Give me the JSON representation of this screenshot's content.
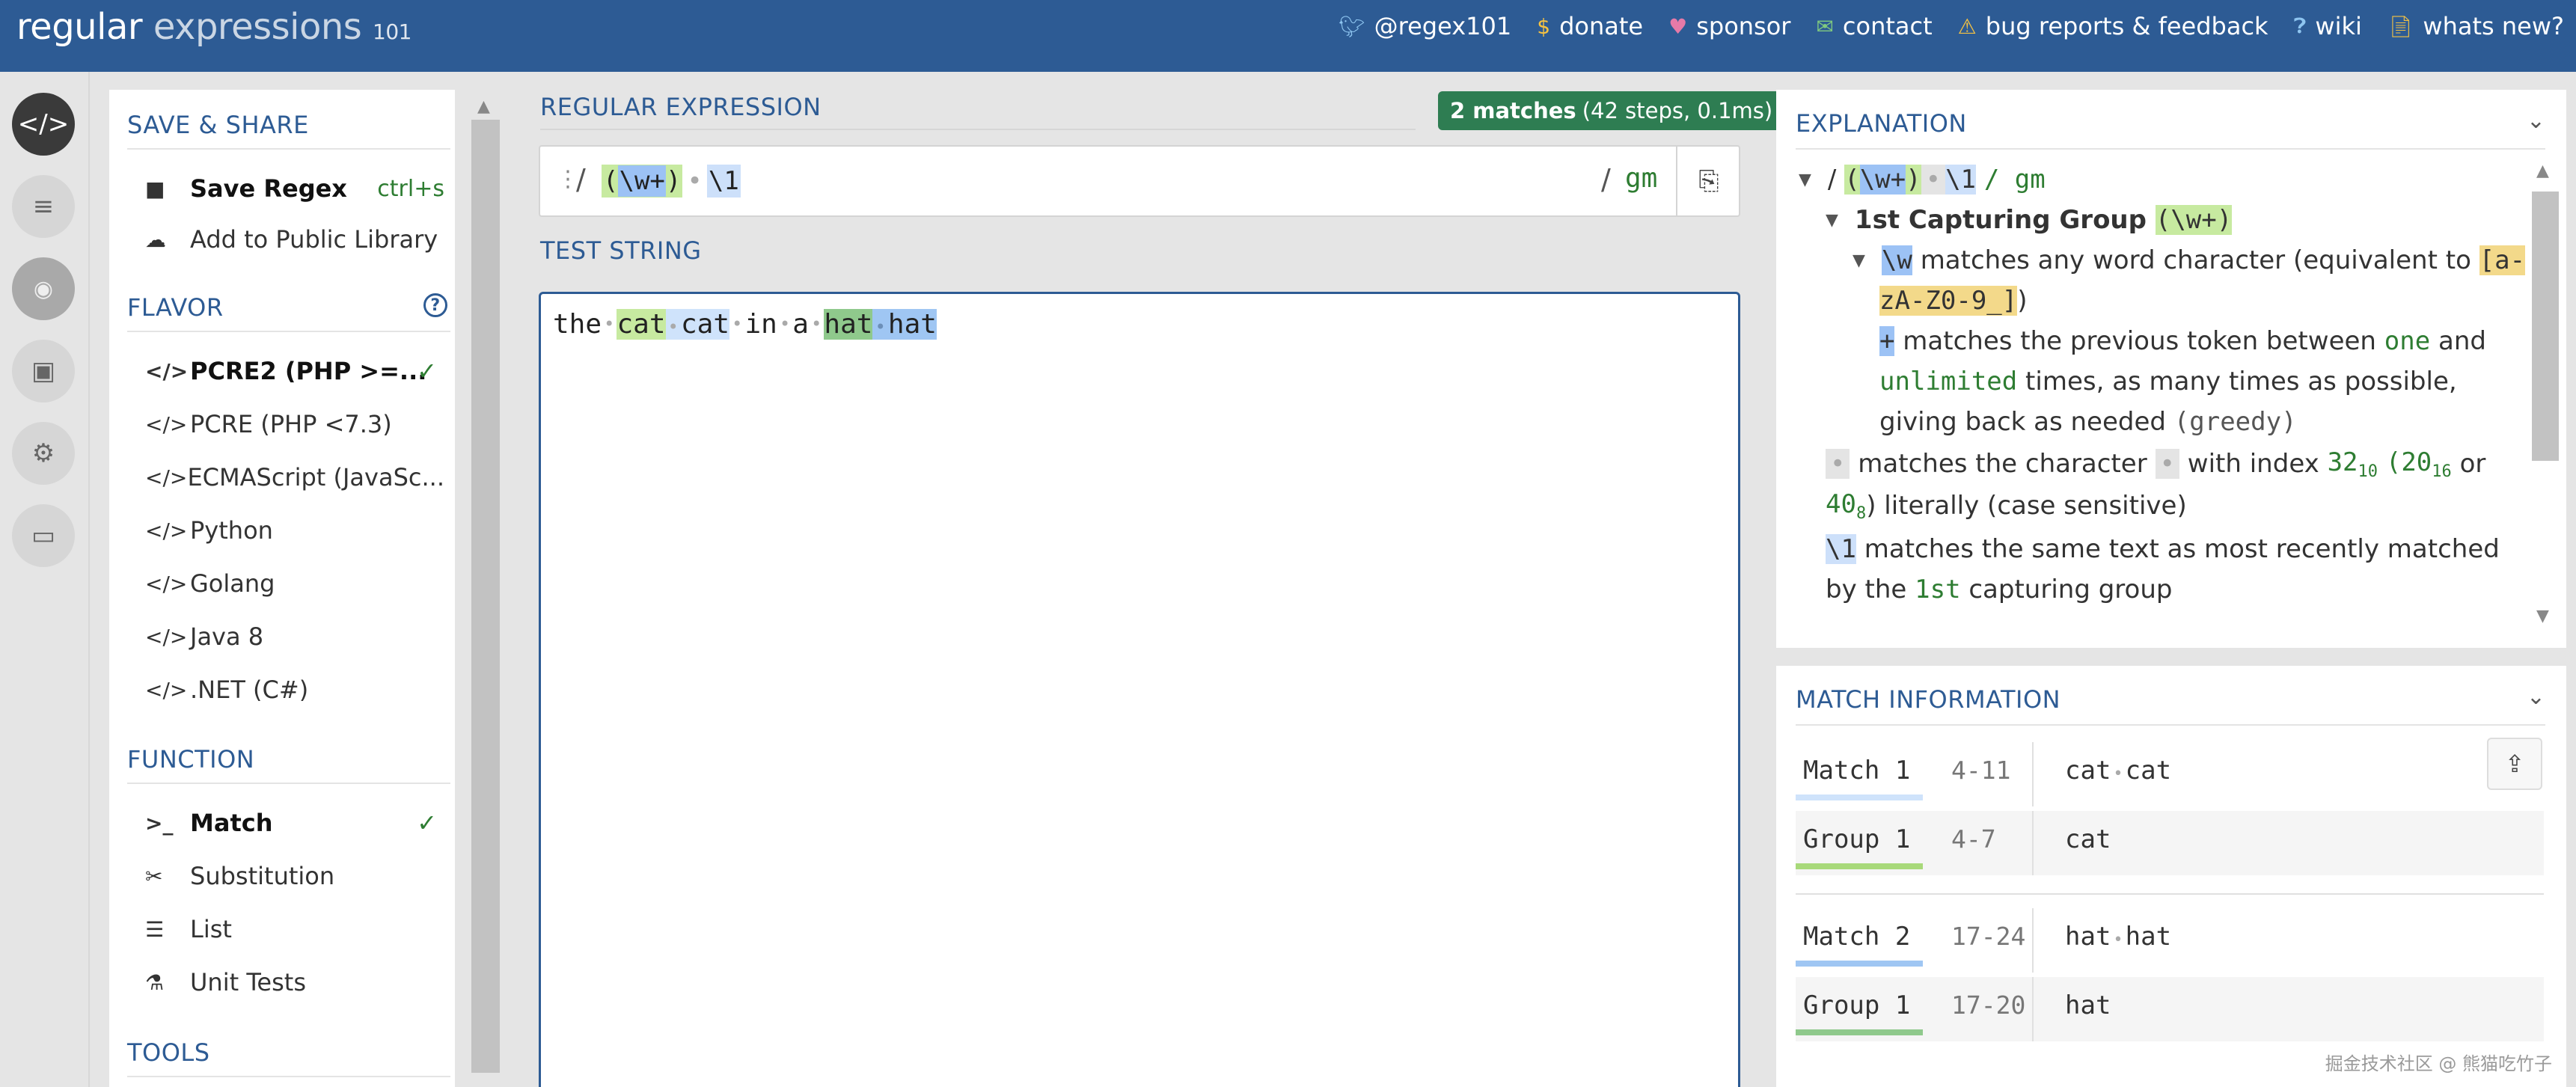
{
  "header": {
    "logo_main": "regular",
    "logo_light": "expressions",
    "logo_sup": "101",
    "nav": [
      {
        "icon": "twitter-icon",
        "label": "@regex101"
      },
      {
        "icon": "dollar-icon",
        "label": "donate"
      },
      {
        "icon": "heart-icon",
        "label": "sponsor"
      },
      {
        "icon": "mail-icon",
        "label": "contact"
      },
      {
        "icon": "warning-icon",
        "label": "bug reports & feedback"
      },
      {
        "icon": "wiki-icon",
        "label": "wiki"
      },
      {
        "icon": "news-icon",
        "label": "whats new?"
      }
    ]
  },
  "rail": [
    "code-icon",
    "library-icon",
    "avatar",
    "gamepad-icon",
    "gear-icon",
    "chat-icon"
  ],
  "sidebar": {
    "save_share": {
      "title": "SAVE & SHARE",
      "save_label": "Save Regex",
      "save_shortcut": "ctrl+s",
      "library_label": "Add to Public Library"
    },
    "flavor": {
      "title": "FLAVOR",
      "items": [
        "PCRE2 (PHP >=...",
        "PCRE (PHP <7.3)",
        "ECMAScript (JavaSc...",
        "Python",
        "Golang",
        "Java 8",
        ".NET (C#)"
      ],
      "selected": 0
    },
    "function": {
      "title": "FUNCTION",
      "items": [
        "Match",
        "Substitution",
        "List",
        "Unit Tests"
      ],
      "selected": 0
    },
    "tools": {
      "title": "TOOLS"
    }
  },
  "editor": {
    "regex_label": "REGULAR EXPRESSION",
    "match_count": "2 matches",
    "match_stats": "(42 steps, 0.1ms)",
    "delim_open": "/",
    "regex_group": "(\\w+)",
    "regex_w": "\\w+",
    "regex_back": "\\1",
    "space_mark": "•",
    "delim_close": "/",
    "flags": "gm",
    "test_label": "TEST STRING",
    "test_string": "the cat cat in a hat hat",
    "test_words": [
      "the",
      "cat",
      "cat",
      "in",
      "a",
      "hat",
      "hat"
    ]
  },
  "explanation": {
    "title": "EXPLANATION",
    "root_delim": "/",
    "root_flags": "/ gm",
    "group_title": "1st Capturing Group",
    "group_token": "(\\w+)",
    "w_token": "\\w",
    "w_text": "matches any word character (equivalent to",
    "w_class_1": "[a-",
    "w_class_2": "zA-Z0-9_]",
    "w_close": ")",
    "plus_token": "+",
    "plus_text_1": "matches the previous token between",
    "plus_one": "one",
    "plus_and": "and",
    "plus_unlimited": "unlimited",
    "plus_text_2": "times, as many times as possible,",
    "plus_text_3": "giving back as needed",
    "plus_greedy": "(greedy)",
    "space_text_1": "matches the character",
    "space_text_2": "with index",
    "idx_dec": "32",
    "idx_dec_base": "10",
    "idx_hex": "(20",
    "idx_hex_base": "16",
    "idx_or": "or",
    "idx_oct": "40",
    "idx_oct_base": "8",
    "space_text_3": ") literally (case sensitive)",
    "back_token": "\\1",
    "back_text_1": "matches the same text as most recently matched",
    "back_text_2": "by the",
    "back_ordinal": "1st",
    "back_text_3": "capturing group"
  },
  "match_info": {
    "title": "MATCH INFORMATION",
    "rows": [
      {
        "name": "Match 1",
        "range": "4-11",
        "value_a": "cat",
        "value_b": "cat",
        "kind": "match1"
      },
      {
        "name": "Group 1",
        "range": "4-7",
        "value_a": "cat",
        "value_b": "",
        "kind": "group1"
      },
      {
        "name": "Match 2",
        "range": "17-24",
        "value_a": "hat",
        "value_b": "hat",
        "kind": "match2"
      },
      {
        "name": "Group 1",
        "range": "17-20",
        "value_a": "hat",
        "value_b": "",
        "kind": "group2"
      }
    ]
  },
  "colors": {
    "header": "#2d5b94",
    "match1": "#cfe3fb",
    "group1": "#c7eaa0",
    "match2": "#9fc6f3",
    "group2": "#8fc98c",
    "badge": "#2e7d52"
  },
  "watermark": "掘金技术社区 @ 熊猫吃竹子"
}
